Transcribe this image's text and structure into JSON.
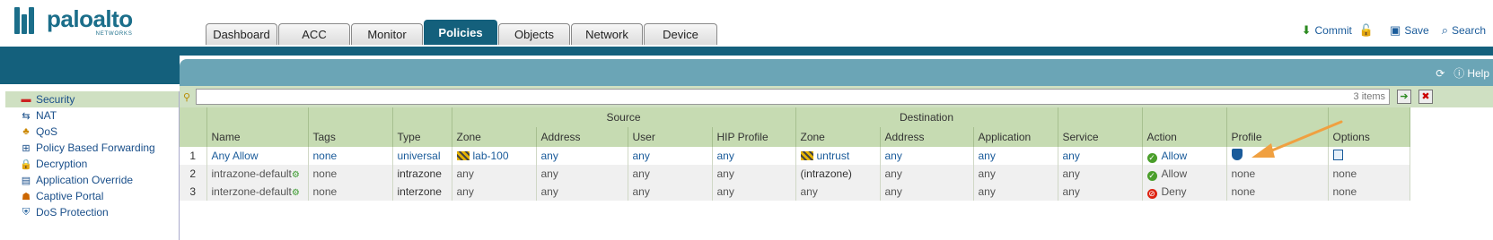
{
  "brand": {
    "name": "paloalto",
    "sub": "NETWORKS",
    "color": "#1b6e8a"
  },
  "tabs": [
    {
      "label": "Dashboard",
      "active": false
    },
    {
      "label": "ACC",
      "active": false
    },
    {
      "label": "Monitor",
      "active": false
    },
    {
      "label": "Policies",
      "active": true
    },
    {
      "label": "Objects",
      "active": false
    },
    {
      "label": "Network",
      "active": false
    },
    {
      "label": "Device",
      "active": false
    }
  ],
  "toplinks": {
    "commit": "Commit",
    "save": "Save",
    "search": "Search"
  },
  "panel": {
    "help": "Help"
  },
  "nav": [
    {
      "label": "Security",
      "icon": "security-icon",
      "selected": true
    },
    {
      "label": "NAT",
      "icon": "nat-icon",
      "selected": false
    },
    {
      "label": "QoS",
      "icon": "qos-icon",
      "selected": false
    },
    {
      "label": "Policy Based Forwarding",
      "icon": "pbf-icon",
      "selected": false
    },
    {
      "label": "Decryption",
      "icon": "lock-icon",
      "selected": false
    },
    {
      "label": "Application Override",
      "icon": "override-icon",
      "selected": false
    },
    {
      "label": "Captive Portal",
      "icon": "portal-icon",
      "selected": false
    },
    {
      "label": "DoS Protection",
      "icon": "dos-icon",
      "selected": false
    }
  ],
  "filter": {
    "count": "3 items"
  },
  "table": {
    "groups": {
      "source": "Source",
      "destination": "Destination"
    },
    "columns": [
      "Name",
      "Tags",
      "Type",
      "Zone",
      "Address",
      "User",
      "HIP Profile",
      "Zone",
      "Address",
      "Application",
      "Service",
      "Action",
      "Profile",
      "Options"
    ],
    "rows": [
      {
        "idx": "1",
        "name": "Any Allow",
        "tags": "none",
        "type": "universal",
        "src_zone": "lab-100",
        "src_addr": "any",
        "user": "any",
        "hip": "any",
        "dst_zone": "untrust",
        "dst_addr": "any",
        "app": "any",
        "service": "any",
        "action": "Allow",
        "profile": "",
        "options": ""
      },
      {
        "idx": "2",
        "name": "intrazone-default",
        "tags": "none",
        "type": "intrazone",
        "src_zone": "any",
        "src_addr": "any",
        "user": "any",
        "hip": "any",
        "dst_zone": "(intrazone)",
        "dst_addr": "any",
        "app": "any",
        "service": "any",
        "action": "Allow",
        "profile": "none",
        "options": "none"
      },
      {
        "idx": "3",
        "name": "interzone-default",
        "tags": "none",
        "type": "interzone",
        "src_zone": "any",
        "src_addr": "any",
        "user": "any",
        "hip": "any",
        "dst_zone": "any",
        "dst_addr": "any",
        "app": "any",
        "service": "any",
        "action": "Deny",
        "profile": "none",
        "options": "none"
      }
    ]
  },
  "colors": {
    "accent": "#14607c",
    "header_green": "#c6dbb2",
    "arrow": "#f0a040"
  }
}
